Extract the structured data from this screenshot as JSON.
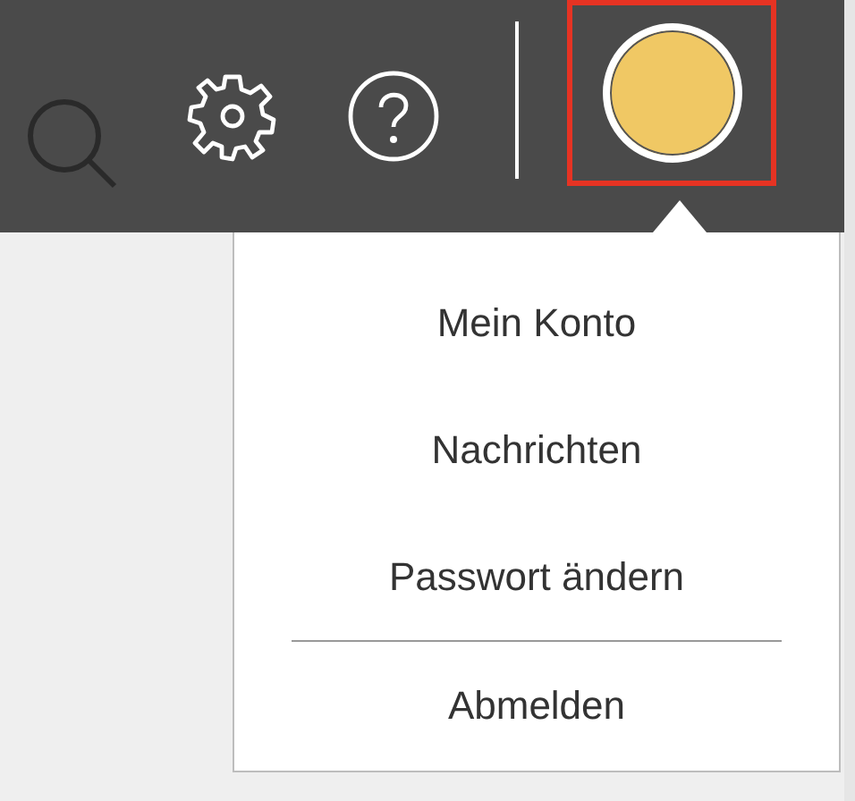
{
  "toolbar": {
    "avatar": {
      "color": "#f0c864",
      "highlighted": true,
      "menu_open": true
    }
  },
  "user_menu": {
    "items": [
      {
        "label": "Mein Konto",
        "divider_before": false
      },
      {
        "label": "Nachrichten",
        "divider_before": false
      },
      {
        "label": "Passwort ändern",
        "divider_before": false
      },
      {
        "label": "Abmelden",
        "divider_before": true
      }
    ]
  }
}
